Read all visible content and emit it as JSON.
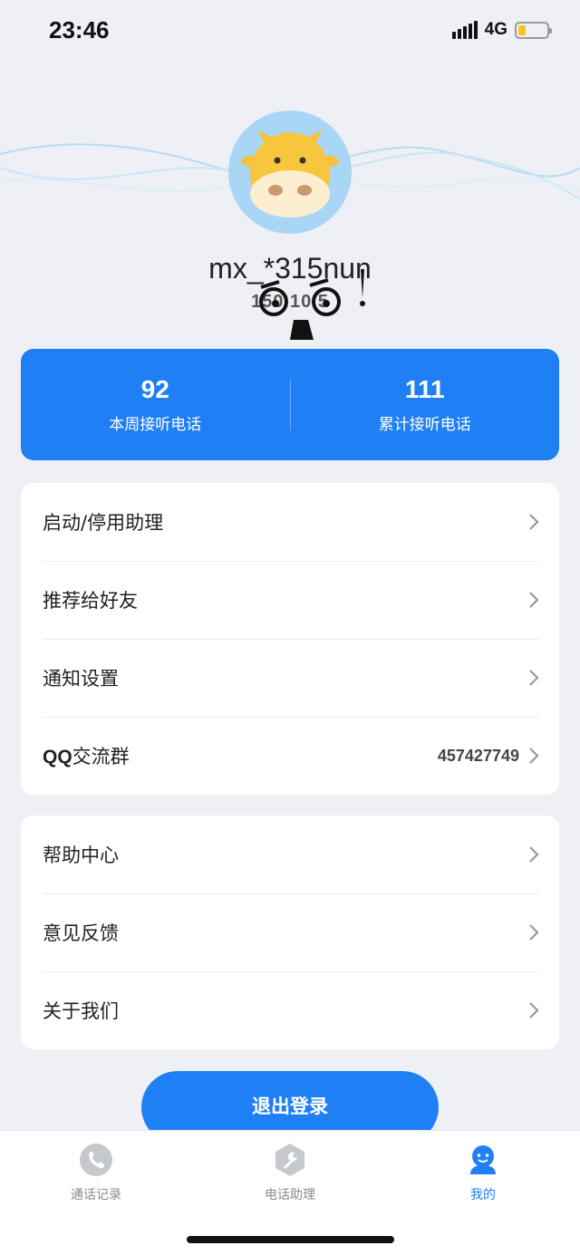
{
  "status_bar": {
    "time": "23:46",
    "network": "4G",
    "battery_level": 0.25
  },
  "profile": {
    "username": "mx_*315nun",
    "phone": "150  10  5",
    "avatar_icon": "cow-avatar-icon"
  },
  "stats": [
    {
      "value": "92",
      "label": "本周接听电话"
    },
    {
      "value": "111",
      "label": "累计接听电话"
    }
  ],
  "menu_group_1": [
    {
      "label": "启动/停用助理",
      "value": ""
    },
    {
      "label": "推荐给好友",
      "value": ""
    },
    {
      "label": "通知设置",
      "value": ""
    },
    {
      "label_prefix": "QQ",
      "label": "交流群",
      "value": "457427749"
    }
  ],
  "menu_group_2": [
    {
      "label": "帮助中心"
    },
    {
      "label": "意见反馈"
    },
    {
      "label": "关于我们"
    }
  ],
  "logout_label": "退出登录",
  "tabs": [
    {
      "label": "通话记录",
      "icon": "phone-icon",
      "active": false
    },
    {
      "label": "电话助理",
      "icon": "wrench-icon",
      "active": false
    },
    {
      "label": "我的",
      "icon": "user-icon",
      "active": true
    }
  ],
  "colors": {
    "accent": "#1f7ff5",
    "background": "#eef0f6",
    "inactive_tab": "#8a8a8a"
  }
}
